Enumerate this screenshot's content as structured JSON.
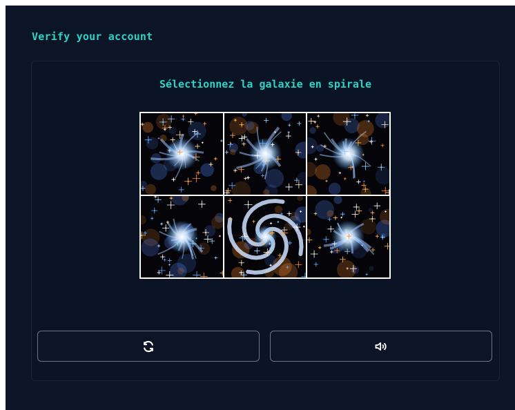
{
  "header": {
    "title": "Verify your account"
  },
  "captcha": {
    "prompt": "Sélectionnez la galaxie en spirale",
    "tiles": [
      {
        "id": 1,
        "icon": "elliptical-galaxy-icon"
      },
      {
        "id": 2,
        "icon": "elliptical-galaxy-icon"
      },
      {
        "id": 3,
        "icon": "elliptical-galaxy-icon"
      },
      {
        "id": 4,
        "icon": "elliptical-galaxy-icon"
      },
      {
        "id": 5,
        "icon": "spiral-galaxy-icon"
      },
      {
        "id": 6,
        "icon": "elliptical-galaxy-icon"
      }
    ],
    "refresh_icon": "refresh-icon",
    "audio_icon": "speaker-icon"
  },
  "colors": {
    "accent": "#2fd3c6",
    "background": "#0c1526",
    "border": "#6b7688"
  }
}
